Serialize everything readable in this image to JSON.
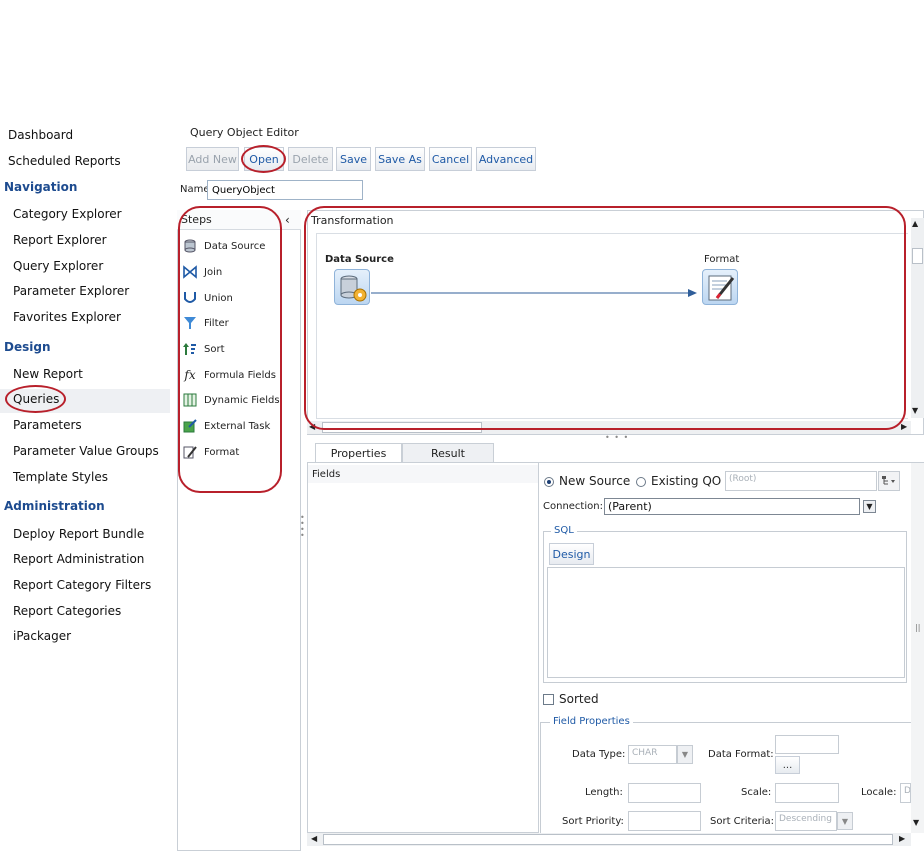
{
  "sidebar": {
    "items": [
      {
        "label": "Dashboard",
        "type": "item"
      },
      {
        "label": "Scheduled Reports",
        "type": "item"
      },
      {
        "label": "Navigation",
        "type": "heading"
      },
      {
        "label": "Category Explorer",
        "type": "sub"
      },
      {
        "label": "Report Explorer",
        "type": "sub"
      },
      {
        "label": "Query Explorer",
        "type": "sub"
      },
      {
        "label": "Parameter Explorer",
        "type": "sub"
      },
      {
        "label": "Favorites Explorer",
        "type": "sub"
      },
      {
        "label": "Design",
        "type": "heading"
      },
      {
        "label": "New Report",
        "type": "sub"
      },
      {
        "label": "Queries",
        "type": "sub",
        "selected": true
      },
      {
        "label": "Parameters",
        "type": "sub"
      },
      {
        "label": "Parameter Value Groups",
        "type": "sub"
      },
      {
        "label": "Template Styles",
        "type": "sub"
      },
      {
        "label": "Administration",
        "type": "heading"
      },
      {
        "label": "Deploy Report Bundle",
        "type": "sub"
      },
      {
        "label": "Report Administration",
        "type": "sub"
      },
      {
        "label": "Report Category Filters",
        "type": "sub"
      },
      {
        "label": "Report Categories",
        "type": "sub"
      },
      {
        "label": "iPackager",
        "type": "sub"
      }
    ]
  },
  "editor": {
    "title": "Query Object Editor",
    "toolbar": {
      "add_new": "Add New",
      "open": "Open",
      "delete": "Delete",
      "save": "Save",
      "save_as": "Save As",
      "cancel": "Cancel",
      "advanced": "Advanced"
    },
    "name_label": "Name",
    "name_value": "QueryObject"
  },
  "steps": {
    "title": "Steps",
    "items": [
      {
        "label": "Data Source",
        "icon": "database-icon"
      },
      {
        "label": "Join",
        "icon": "join-icon"
      },
      {
        "label": "Union",
        "icon": "union-icon"
      },
      {
        "label": "Filter",
        "icon": "filter-icon"
      },
      {
        "label": "Sort",
        "icon": "sort-icon"
      },
      {
        "label": "Formula Fields",
        "icon": "formula-icon"
      },
      {
        "label": "Dynamic Fields",
        "icon": "dynamic-fields-icon"
      },
      {
        "label": "External Task",
        "icon": "external-task-icon"
      },
      {
        "label": "Format",
        "icon": "format-icon"
      }
    ]
  },
  "transformation": {
    "title": "Transformation",
    "nodes": {
      "source": "Data Source",
      "target": "Format"
    }
  },
  "tabs": {
    "properties": "Properties",
    "result": "Result"
  },
  "fields": {
    "title": "Fields"
  },
  "properties": {
    "new_source": "New Source",
    "existing_qo": "Existing QO",
    "root_placeholder": "(Root)",
    "connection_label": "Connection:",
    "connection_value": "(Parent)",
    "sql_legend": "SQL",
    "design_button": "Design",
    "sorted_label": "Sorted",
    "field_properties_legend": "Field Properties",
    "data_type_label": "Data Type:",
    "data_type_value": "CHAR",
    "data_format_label": "Data Format:",
    "ellipsis": "...",
    "length_label": "Length:",
    "scale_label": "Scale:",
    "locale_label": "Locale:",
    "locale_value": "De",
    "sort_priority_label": "Sort Priority:",
    "sort_criteria_label": "Sort Criteria:",
    "sort_criteria_value": "Descending"
  },
  "colors": {
    "heading": "#1d4b8f",
    "button_text": "#1f5aa6",
    "annotation": "#b8202b"
  }
}
